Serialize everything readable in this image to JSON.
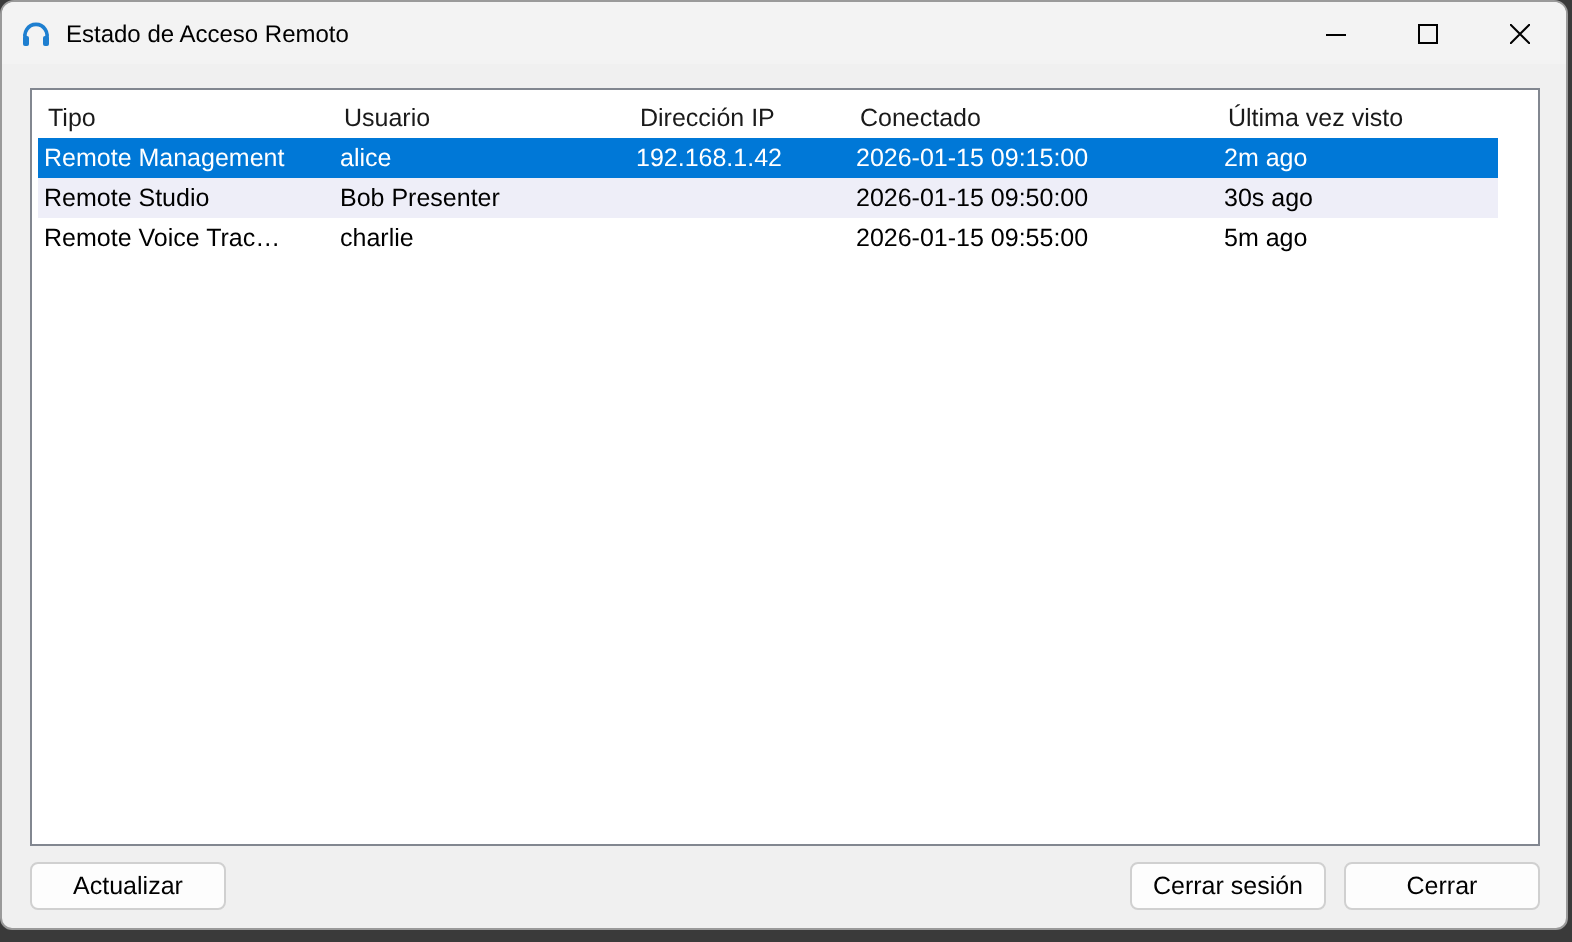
{
  "window": {
    "title": "Estado de Acceso Remoto"
  },
  "table": {
    "columns": [
      "Tipo",
      "Usuario",
      "Dirección IP",
      "Conectado",
      "Última vez visto"
    ],
    "rows": [
      {
        "type": "Remote Management",
        "user": "alice",
        "ip": "192.168.1.42",
        "connected": "2026-01-15 09:15:00",
        "last_seen": "2m ago",
        "selected": true
      },
      {
        "type": "Remote Studio",
        "user": "Bob Presenter",
        "connected": "2026-01-15 09:50:00",
        "last_seen": "30s ago",
        "selected": false
      },
      {
        "type": "Remote Voice Trac…",
        "user": "charlie",
        "connected": "2026-01-15 09:55:00",
        "last_seen": "5m ago",
        "selected": false
      }
    ]
  },
  "buttons_left": [
    "Actualizar"
  ],
  "buttons_right": [
    "Cerrar sesión",
    "Cerrar"
  ]
}
